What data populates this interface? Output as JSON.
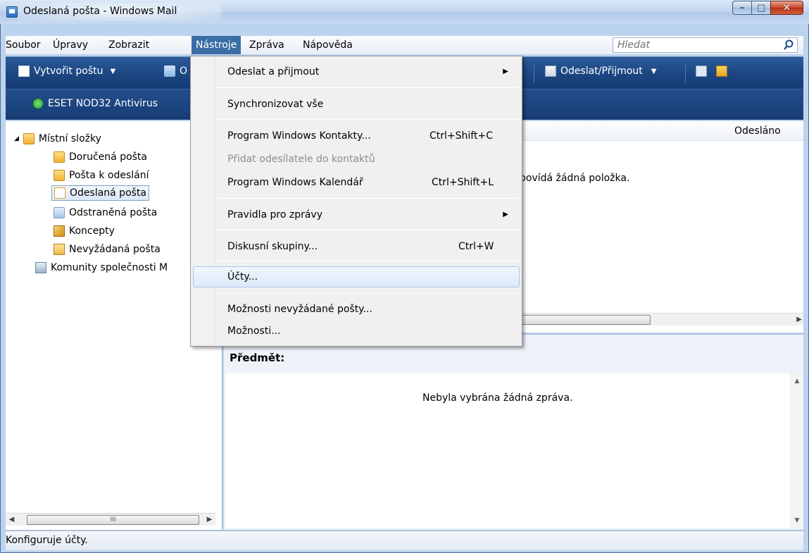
{
  "window": {
    "title": "Odeslaná pošta - Windows Mail",
    "minimize": "–",
    "maximize": "□",
    "close": "✕"
  },
  "menubar": {
    "items": [
      "Soubor",
      "Úpravy",
      "Zobrazit",
      "Nástroje",
      "Zpráva",
      "Nápověda"
    ],
    "active": "Nástroje",
    "search_placeholder": "Hledat"
  },
  "toolbar": {
    "new_mail": "Vytvořit poštu",
    "reply_partial": "O",
    "send_receive": "Odeslat/Přijmout",
    "antivirus": "ESET NOD32 Antivirus"
  },
  "folders": {
    "root": "Místní složky",
    "items": [
      "Doručená pošta",
      "Pošta k odeslání",
      "Odeslaná pošta",
      "Odstraněná pošta",
      "Koncepty",
      "Nevyžádaná pošta"
    ],
    "selected": "Odeslaná pošta",
    "community": "Komunity společnosti M"
  },
  "message_list": {
    "column_sent": "Odesláno",
    "empty_text": "povídá žádná položka."
  },
  "preview": {
    "subject_label": "Předmět:",
    "no_message": "Nebyla vybrána žádná zpráva."
  },
  "dropdown": {
    "items": [
      {
        "label": "Odeslat a přijmout",
        "submenu": true
      },
      {
        "label": "Synchronizovat vše"
      },
      {
        "label": "Program Windows Kontakty...",
        "shortcut": "Ctrl+Shift+C"
      },
      {
        "label": "Přidat odesílatele do kontaktů",
        "disabled": true
      },
      {
        "label": "Program Windows Kalendář",
        "shortcut": "Ctrl+Shift+L"
      },
      {
        "label": "Pravidla pro zprávy",
        "submenu": true
      },
      {
        "label": "Diskusní skupiny...",
        "shortcut": "Ctrl+W"
      },
      {
        "label": "Účty...",
        "hover": true
      },
      {
        "label": "Možnosti nevyžádané pošty..."
      },
      {
        "label": "Možnosti..."
      }
    ]
  },
  "statusbar": {
    "text": "Konfiguruje účty."
  },
  "scrollbar": {
    "grip": "III"
  }
}
